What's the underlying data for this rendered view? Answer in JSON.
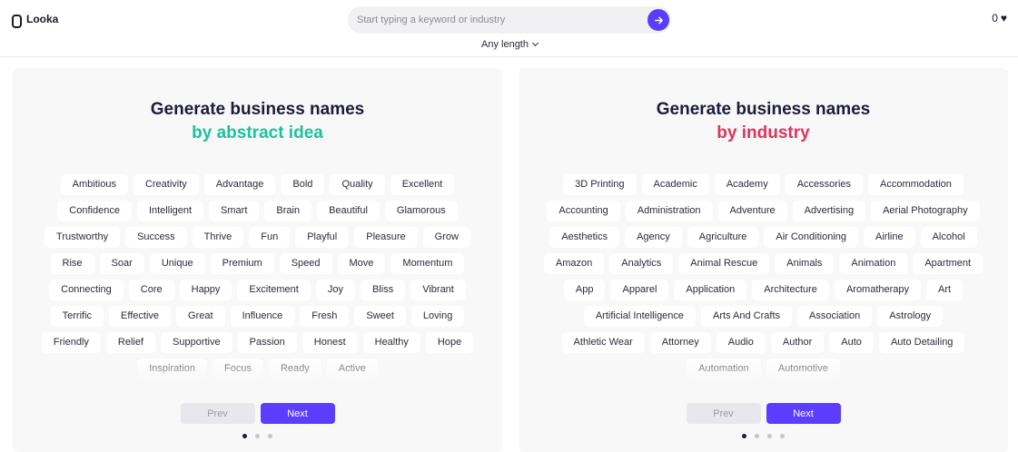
{
  "header": {
    "logo_text": "Looka",
    "search_placeholder": "Start typing a keyword or industry",
    "length_filter": "Any length",
    "favorites_count": "0"
  },
  "colors": {
    "accent": "#5a3dff",
    "abstract": "#1fc19a",
    "industry": "#e0345c"
  },
  "left_panel": {
    "title": "Generate business names",
    "subtitle": "by abstract idea",
    "tags": [
      "Ambitious",
      "Creativity",
      "Advantage",
      "Bold",
      "Quality",
      "Excellent",
      "Confidence",
      "Intelligent",
      "Smart",
      "Brain",
      "Beautiful",
      "Glamorous",
      "Trustworthy",
      "Success",
      "Thrive",
      "Fun",
      "Playful",
      "Pleasure",
      "Grow",
      "Rise",
      "Soar",
      "Unique",
      "Premium",
      "Speed",
      "Move",
      "Momentum",
      "Connecting",
      "Core",
      "Happy",
      "Excitement",
      "Joy",
      "Bliss",
      "Vibrant",
      "Terrific",
      "Effective",
      "Great",
      "Influence",
      "Fresh",
      "Sweet",
      "Loving",
      "Friendly",
      "Relief",
      "Supportive",
      "Passion",
      "Honest",
      "Healthy",
      "Hope",
      "Inspiration",
      "Focus",
      "Ready",
      "Active"
    ],
    "prev_label": "Prev",
    "next_label": "Next"
  },
  "right_panel": {
    "title": "Generate business names",
    "subtitle": "by industry",
    "tags": [
      "3D Printing",
      "Academic",
      "Academy",
      "Accessories",
      "Accommodation",
      "Accounting",
      "Administration",
      "Adventure",
      "Advertising",
      "Aerial Photography",
      "Aesthetics",
      "Agency",
      "Agriculture",
      "Air Conditioning",
      "Airline",
      "Alcohol",
      "Amazon",
      "Analytics",
      "Animal Rescue",
      "Animals",
      "Animation",
      "Apartment",
      "App",
      "Apparel",
      "Application",
      "Architecture",
      "Aromatherapy",
      "Art",
      "Artificial Intelligence",
      "Arts And Crafts",
      "Association",
      "Astrology",
      "Athletic Wear",
      "Attorney",
      "Audio",
      "Author",
      "Auto",
      "Auto Detailing",
      "Automation",
      "Automotive"
    ],
    "prev_label": "Prev",
    "next_label": "Next"
  }
}
